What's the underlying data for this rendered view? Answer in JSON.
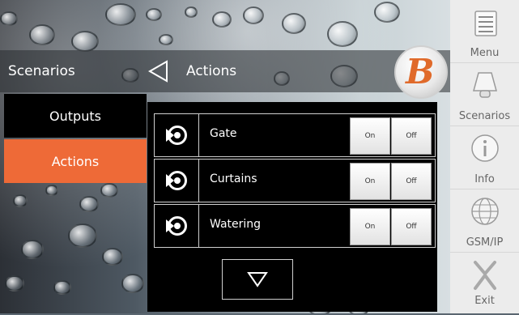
{
  "header": {
    "title": "Scenarios",
    "subtitle": "Actions"
  },
  "logo": {
    "letter": "B"
  },
  "tabs": [
    {
      "label": "Outputs"
    },
    {
      "label": "Actions"
    }
  ],
  "actions": [
    {
      "label": "Gate",
      "on_label": "On",
      "off_label": "Off"
    },
    {
      "label": "Curtains",
      "on_label": "On",
      "off_label": "Off"
    },
    {
      "label": "Watering",
      "on_label": "On",
      "off_label": "Off"
    }
  ],
  "sidebar": {
    "items": [
      {
        "label": "Menu",
        "icon": "menu-icon"
      },
      {
        "label": "Scenarios",
        "icon": "scenarios-icon"
      },
      {
        "label": "Info",
        "icon": "info-icon"
      },
      {
        "label": "GSM/IP",
        "icon": "globe-icon"
      },
      {
        "label": "Exit",
        "icon": "exit-icon"
      }
    ]
  },
  "colors": {
    "accent": "#ee6a37",
    "panel": "#000000",
    "sidebar": "#ececec"
  }
}
